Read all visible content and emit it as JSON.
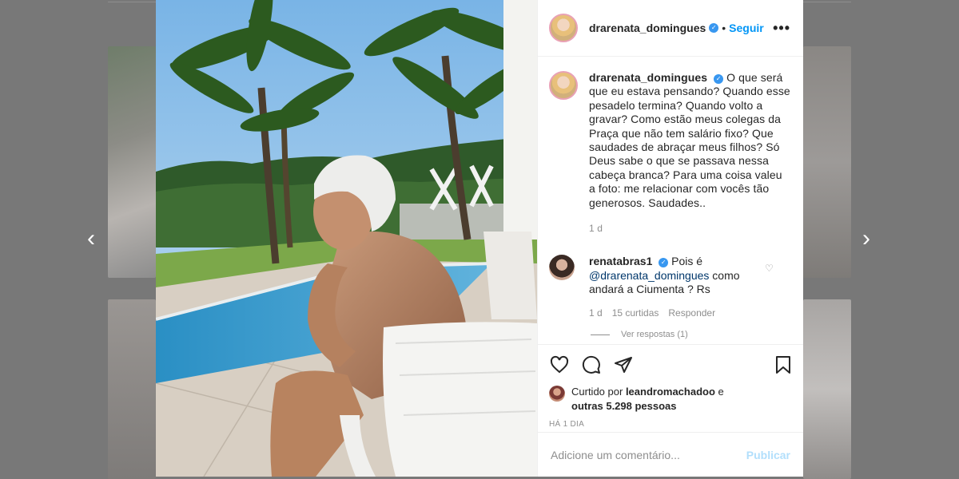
{
  "post": {
    "username": "drarenata_domingues",
    "follow_label": "Seguir",
    "more_label": "•••",
    "caption": "O que será que eu estava pensando? Quando esse pesadelo termina? Quando volto a gravar? Como estão meus colegas da Praça que não tem salário fixo? Que saudades de abraçar meus filhos? Só Deus sabe o que se passava nessa cabeça branca? Para uma coisa valeu a foto: me relacionar com vocês tão generosos. Saudades..",
    "caption_age": "1 d"
  },
  "comment": {
    "username": "renatabras1",
    "text_before": "Pois é ",
    "mention": "@drarenata_domingues",
    "text_after": " como andará a Ciumenta ? Rs",
    "age": "1 d",
    "likes": "15 curtidas",
    "reply_label": "Responder",
    "see_replies": "Ver respostas (1)"
  },
  "likes": {
    "prefix": "Curtido por",
    "user": "leandromachadoo",
    "middle": "e",
    "others": "outras 5.298 pessoas"
  },
  "time_ago": "HÁ 1 DIA",
  "add_comment": {
    "placeholder": "Adicione um comentário...",
    "publish_label": "Publicar"
  },
  "nav": {
    "prev": "‹",
    "next": "›"
  },
  "colors": {
    "accent": "#0095f6",
    "verified": "#3897f0",
    "publish_disabled": "#b2dffc",
    "overlay": "#787878"
  }
}
